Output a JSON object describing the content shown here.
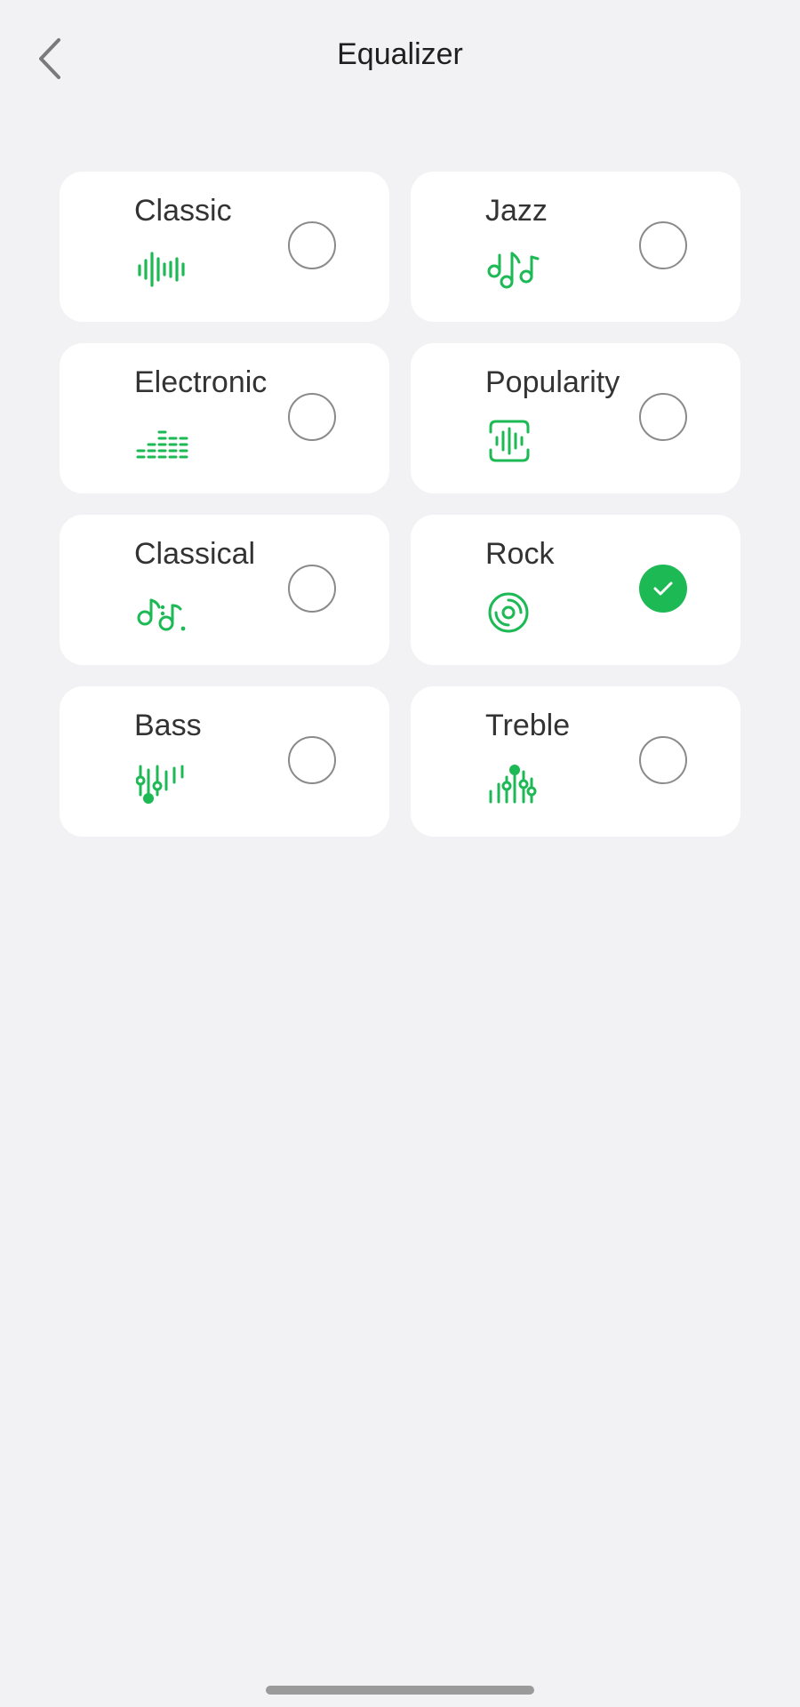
{
  "header": {
    "title": "Equalizer",
    "back_icon": "chevron-left-icon"
  },
  "accent_color": "#1db954",
  "selected_preset": "Rock",
  "presets": [
    {
      "id": "classic",
      "label": "Classic",
      "icon": "waveform-icon",
      "selected": false
    },
    {
      "id": "jazz",
      "label": "Jazz",
      "icon": "music-notes-icon",
      "selected": false
    },
    {
      "id": "electronic",
      "label": "Electronic",
      "icon": "bar-levels-icon",
      "selected": false
    },
    {
      "id": "popularity",
      "label": "Popularity",
      "icon": "framed-waveform-icon",
      "selected": false
    },
    {
      "id": "classical",
      "label": "Classical",
      "icon": "music-note-icon",
      "selected": false
    },
    {
      "id": "rock",
      "label": "Rock",
      "icon": "vinyl-disc-icon",
      "selected": true
    },
    {
      "id": "bass",
      "label": "Bass",
      "icon": "low-sliders-icon",
      "selected": false
    },
    {
      "id": "treble",
      "label": "Treble",
      "icon": "high-sliders-icon",
      "selected": false
    }
  ]
}
